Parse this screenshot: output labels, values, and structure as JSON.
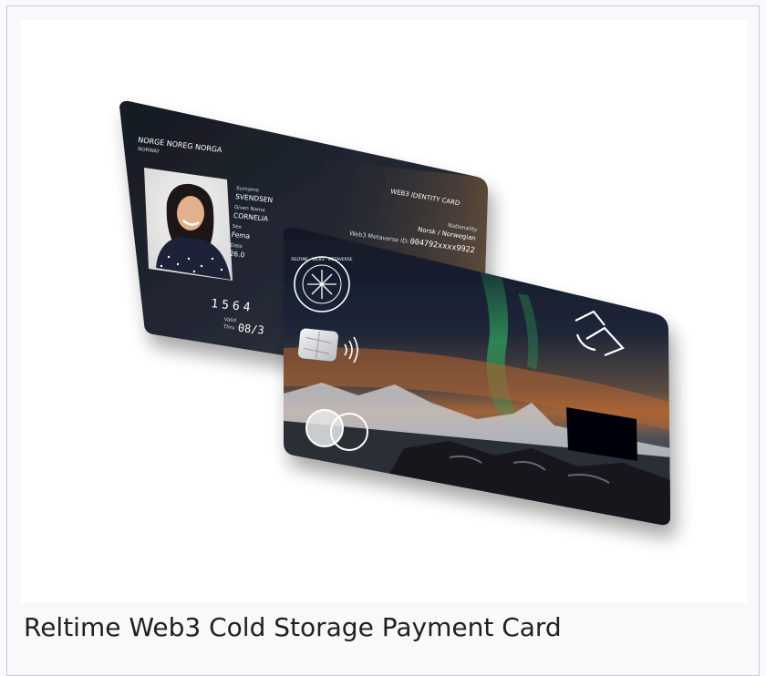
{
  "caption": "Reltime Web3 Cold Storage Payment Card",
  "id_card": {
    "country": "NORGE NOREG NORGA",
    "country_en": "NORWAY",
    "card_type": "WEB3 IDENTITY CARD",
    "surname_label": "Surname",
    "surname": "SVENDSEN",
    "given_name_label": "Given Name",
    "given_name": "CORNELIA",
    "sex_label": "Sex",
    "sex": "Fema",
    "date_label": "Date",
    "date": "26.0",
    "nationality_label": "Nationality",
    "nationality": "Norsk / Norwegian",
    "metaverse_label": "Web3 Metaverse ID:",
    "metaverse_id": "004792xxxx9922",
    "number": "1564",
    "valid_label": "Valid",
    "thru_label": "Thru",
    "valid_thru": "08/3"
  },
  "payment_card": {
    "seal_text": "RELTIME · WEB3 · METAVERSE"
  },
  "colors": {
    "card_dark": "#1c2029",
    "aurora_green": "#2fa35a",
    "sky_orange": "#b5652f",
    "page_bg": "#f8f9fa"
  }
}
